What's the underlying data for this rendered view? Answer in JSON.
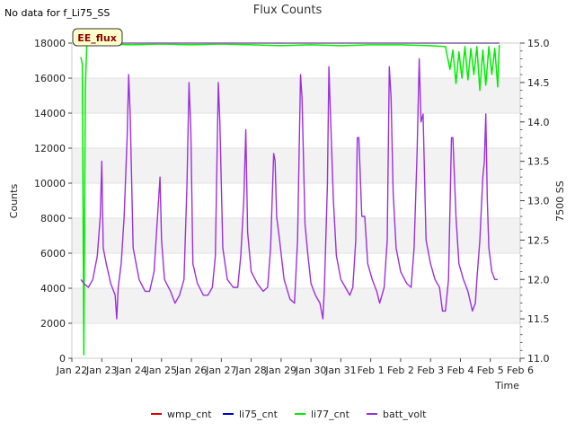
{
  "chart_data": {
    "type": "line",
    "title": "Flux Counts",
    "no_data_note": "No data for f_Li75_SS",
    "badge": "EE_flux",
    "xlabel": "Time",
    "ylabel": "Counts",
    "y2label": "7500 SS",
    "x_ticks": [
      "Jan 22",
      "Jan 23",
      "Jan 24",
      "Jan 25",
      "Jan 26",
      "Jan 27",
      "Jan 28",
      "Jan 29",
      "Jan 30",
      "Jan 31",
      "Feb 1",
      "Feb 2",
      "Feb 3",
      "Feb 4",
      "Feb 5",
      "Feb 6"
    ],
    "xlim": [
      0,
      15
    ],
    "ylim": [
      0,
      18000
    ],
    "y_ticks": [
      "0",
      "2000",
      "4000",
      "6000",
      "8000",
      "10000",
      "12000",
      "14000",
      "16000",
      "18000"
    ],
    "y2lim": [
      11.0,
      15.0
    ],
    "y2_ticks": [
      "11.0",
      "11.5",
      "12.0",
      "12.5",
      "13.0",
      "13.5",
      "14.0",
      "14.5",
      "15.0"
    ],
    "grid": "horizontal bands",
    "legend_position": "bottom",
    "series": [
      {
        "name": "wmp_cnt",
        "color": "#dd0000",
        "axis": "left",
        "points": [
          [
            0.3,
            18000
          ],
          [
            14.3,
            18000
          ]
        ]
      },
      {
        "name": "li75_cnt",
        "color": "#0000cc",
        "axis": "left",
        "points": [
          [
            0.3,
            18000
          ],
          [
            14.3,
            18000
          ]
        ]
      },
      {
        "name": "li77_cnt",
        "color": "#00ee00",
        "axis": "left",
        "points": [
          [
            0.3,
            17200
          ],
          [
            0.35,
            16800
          ],
          [
            0.4,
            200
          ],
          [
            0.45,
            15500
          ],
          [
            0.5,
            17900
          ],
          [
            1.0,
            17950
          ],
          [
            2.0,
            17900
          ],
          [
            3.0,
            17950
          ],
          [
            4.0,
            17900
          ],
          [
            5.0,
            17950
          ],
          [
            6.0,
            17900
          ],
          [
            7.0,
            17850
          ],
          [
            8.0,
            17900
          ],
          [
            9.0,
            17850
          ],
          [
            10.0,
            17900
          ],
          [
            11.0,
            17900
          ],
          [
            12.0,
            17850
          ],
          [
            12.5,
            17800
          ],
          [
            12.65,
            16500
          ],
          [
            12.75,
            17600
          ],
          [
            12.85,
            15700
          ],
          [
            12.95,
            17500
          ],
          [
            13.05,
            16000
          ],
          [
            13.15,
            17800
          ],
          [
            13.25,
            15900
          ],
          [
            13.35,
            17700
          ],
          [
            13.45,
            16200
          ],
          [
            13.55,
            17800
          ],
          [
            13.65,
            15300
          ],
          [
            13.75,
            17600
          ],
          [
            13.85,
            15600
          ],
          [
            13.95,
            17800
          ],
          [
            14.05,
            16200
          ],
          [
            14.15,
            17700
          ],
          [
            14.25,
            15500
          ],
          [
            14.3,
            17900
          ]
        ]
      },
      {
        "name": "batt_volt",
        "color": "#9b30e0",
        "axis": "right",
        "points": [
          [
            0.3,
            12.0
          ],
          [
            0.4,
            11.95
          ],
          [
            0.55,
            11.9
          ],
          [
            0.7,
            12.0
          ],
          [
            0.85,
            12.3
          ],
          [
            0.95,
            12.8
          ],
          [
            1.0,
            13.5
          ],
          [
            1.05,
            12.4
          ],
          [
            1.15,
            12.2
          ],
          [
            1.3,
            11.95
          ],
          [
            1.45,
            11.8
          ],
          [
            1.5,
            11.5
          ],
          [
            1.55,
            11.9
          ],
          [
            1.65,
            12.2
          ],
          [
            1.75,
            12.8
          ],
          [
            1.85,
            13.8
          ],
          [
            1.9,
            14.6
          ],
          [
            1.95,
            14.1
          ],
          [
            2.05,
            12.4
          ],
          [
            2.25,
            12.0
          ],
          [
            2.45,
            11.85
          ],
          [
            2.6,
            11.85
          ],
          [
            2.75,
            12.1
          ],
          [
            2.85,
            12.7
          ],
          [
            2.95,
            13.3
          ],
          [
            3.0,
            12.5
          ],
          [
            3.1,
            12.0
          ],
          [
            3.3,
            11.85
          ],
          [
            3.45,
            11.7
          ],
          [
            3.6,
            11.8
          ],
          [
            3.75,
            12.0
          ],
          [
            3.85,
            13.2
          ],
          [
            3.92,
            14.5
          ],
          [
            3.98,
            13.9
          ],
          [
            4.05,
            12.2
          ],
          [
            4.2,
            11.95
          ],
          [
            4.4,
            11.8
          ],
          [
            4.55,
            11.8
          ],
          [
            4.7,
            11.9
          ],
          [
            4.8,
            12.3
          ],
          [
            4.9,
            14.5
          ],
          [
            4.95,
            14.0
          ],
          [
            5.05,
            12.4
          ],
          [
            5.2,
            12.0
          ],
          [
            5.4,
            11.9
          ],
          [
            5.55,
            11.9
          ],
          [
            5.65,
            12.3
          ],
          [
            5.75,
            13.0
          ],
          [
            5.82,
            13.9
          ],
          [
            5.88,
            12.6
          ],
          [
            6.0,
            12.1
          ],
          [
            6.2,
            11.95
          ],
          [
            6.4,
            11.85
          ],
          [
            6.55,
            11.9
          ],
          [
            6.65,
            12.4
          ],
          [
            6.75,
            13.6
          ],
          [
            6.8,
            13.5
          ],
          [
            6.85,
            12.8
          ],
          [
            6.95,
            12.5
          ],
          [
            7.1,
            12.0
          ],
          [
            7.3,
            11.75
          ],
          [
            7.45,
            11.7
          ],
          [
            7.55,
            12.5
          ],
          [
            7.65,
            14.6
          ],
          [
            7.7,
            14.3
          ],
          [
            7.8,
            12.7
          ],
          [
            7.9,
            12.3
          ],
          [
            8.0,
            11.95
          ],
          [
            8.15,
            11.8
          ],
          [
            8.3,
            11.7
          ],
          [
            8.4,
            11.5
          ],
          [
            8.45,
            11.9
          ],
          [
            8.55,
            13.2
          ],
          [
            8.6,
            14.7
          ],
          [
            8.65,
            14.1
          ],
          [
            8.75,
            13.0
          ],
          [
            8.85,
            12.3
          ],
          [
            9.0,
            12.0
          ],
          [
            9.15,
            11.9
          ],
          [
            9.3,
            11.8
          ],
          [
            9.4,
            11.9
          ],
          [
            9.5,
            12.5
          ],
          [
            9.55,
            13.8
          ],
          [
            9.6,
            13.8
          ],
          [
            9.7,
            12.8
          ],
          [
            9.8,
            12.8
          ],
          [
            9.9,
            12.2
          ],
          [
            10.05,
            12.0
          ],
          [
            10.2,
            11.85
          ],
          [
            10.3,
            11.7
          ],
          [
            10.45,
            11.9
          ],
          [
            10.55,
            12.5
          ],
          [
            10.62,
            14.7
          ],
          [
            10.68,
            14.3
          ],
          [
            10.75,
            13.1
          ],
          [
            10.85,
            12.4
          ],
          [
            11.0,
            12.1
          ],
          [
            11.2,
            11.95
          ],
          [
            11.35,
            11.9
          ],
          [
            11.45,
            12.4
          ],
          [
            11.55,
            13.6
          ],
          [
            11.62,
            14.8
          ],
          [
            11.68,
            14.0
          ],
          [
            11.75,
            14.1
          ],
          [
            11.85,
            12.5
          ],
          [
            12.0,
            12.2
          ],
          [
            12.15,
            12.0
          ],
          [
            12.3,
            11.9
          ],
          [
            12.4,
            11.6
          ],
          [
            12.5,
            11.6
          ],
          [
            12.6,
            12.0
          ],
          [
            12.7,
            13.8
          ],
          [
            12.75,
            13.8
          ],
          [
            12.85,
            12.8
          ],
          [
            12.95,
            12.2
          ],
          [
            13.1,
            12.0
          ],
          [
            13.25,
            11.85
          ],
          [
            13.4,
            11.6
          ],
          [
            13.5,
            11.7
          ],
          [
            13.55,
            12.0
          ],
          [
            13.65,
            12.5
          ],
          [
            13.75,
            13.3
          ],
          [
            13.8,
            13.5
          ],
          [
            13.85,
            14.1
          ],
          [
            13.9,
            13.0
          ],
          [
            13.95,
            12.4
          ],
          [
            14.05,
            12.1
          ],
          [
            14.15,
            12.0
          ],
          [
            14.25,
            12.0
          ]
        ]
      }
    ]
  }
}
